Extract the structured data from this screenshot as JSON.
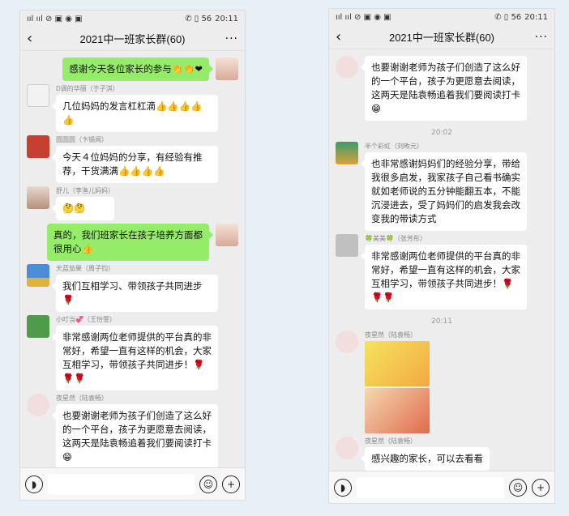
{
  "status": {
    "time": "20:11",
    "left_icons": "ııl ııl ⊘ ▣ ◉ ▣",
    "right_icons": "✆ ▯ 56"
  },
  "left": {
    "title": "2021中一班家长群(60)",
    "messages": [
      {
        "side": "right",
        "text": "感谢今天各位家长的参与👏👏❤"
      },
      {
        "side": "left",
        "sender": "D调的华丽（于子淇）",
        "text": "几位妈妈的发言杠杠滴👍👍👍👍👍"
      },
      {
        "side": "left",
        "sender": "圆圆圆（卞锡闻）",
        "text": "今天４位妈妈的分享，有经验有推荐，干货满满👍👍👍👍"
      },
      {
        "side": "left",
        "sender": "舒儿（李渔儿妈妈）",
        "text": "🤔🤔"
      },
      {
        "side": "right",
        "text": "真的，我们班家长在孩子培养方面都很用心👍"
      },
      {
        "side": "left",
        "sender": "天蓝茄果（周子钧）",
        "text": "我们互相学习、带领孩子共同进步🌹"
      },
      {
        "side": "left",
        "sender": "小叮当💞（王怡雯）",
        "text": "非常感谢两位老师提供的平台真的非常好，希望一直有这样的机会，大家互相学习，带领孩子共同进步！🌹🌹🌹"
      },
      {
        "side": "left",
        "sender": "夜星然（陆袁畅）",
        "text": "也要谢谢老师为孩子们创造了这么好的一个平台，孩子为更愿意去阅读，这两天是陆袁畅追着我们要阅读打卡😁"
      }
    ]
  },
  "right": {
    "title": "2021中一班家长群(60)",
    "messages": [
      {
        "side": "left",
        "sender": "",
        "text": "也要谢谢老师为孩子们创造了这么好的一个平台，孩子为更愿意去阅读，这两天是陆袁畅追着我们要阅读打卡😁"
      },
      {
        "type": "time",
        "text": "20:02"
      },
      {
        "side": "left",
        "sender": "半个彩虹（刘畋元）",
        "text": "也非常感谢妈妈们的经验分享，带给我很多启发，我家孩子自己看书确实就如老师说的五分钟能翻五本，不能沉浸进去，受了妈妈们的启发我会改变我的带读方式"
      },
      {
        "side": "left",
        "sender": "🍀美美🍀（张芳彤）",
        "text": "非常感谢两位老师提供的平台真的非常好，希望一直有这样的机会，大家互相学习，带领孩子共同进步！🌹🌹🌹"
      },
      {
        "type": "time",
        "text": "20:11"
      },
      {
        "side": "left",
        "sender": "夜星然（陆袁畅）",
        "type": "images"
      },
      {
        "side": "left",
        "sender": "夜星然（陆袁畅）",
        "text": "感兴趣的家长，可以去看看"
      }
    ]
  },
  "colors": {
    "bubble_green": "#95ec69",
    "bubble_white": "#ffffff",
    "bg": "#ededed"
  }
}
